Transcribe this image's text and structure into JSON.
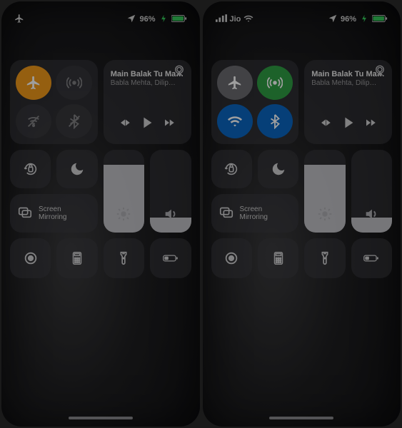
{
  "screens": [
    {
      "status": {
        "left_mode": "airplane",
        "carrier": "",
        "wifi": false,
        "battery_pct": "96%"
      },
      "connectivity": {
        "airplane": {
          "on": true,
          "style": "orange"
        },
        "cellular": {
          "on": false,
          "style": "dim"
        },
        "wifi": {
          "on": false,
          "style": "dim"
        },
        "bluetooth": {
          "on": false,
          "style": "dim"
        }
      },
      "media": {
        "title": "Main Balak Tu Ma…",
        "artist": "Babla Mehta, Dilip…"
      },
      "screen_mirroring": {
        "line1": "Screen",
        "line2": "Mirroring"
      },
      "brightness_pct": 82,
      "volume_pct": 18
    },
    {
      "status": {
        "left_mode": "signal",
        "carrier": "Jio",
        "wifi": true,
        "battery_pct": "96%"
      },
      "connectivity": {
        "airplane": {
          "on": false,
          "style": "grey"
        },
        "cellular": {
          "on": true,
          "style": "green"
        },
        "wifi": {
          "on": true,
          "style": "blue"
        },
        "bluetooth": {
          "on": true,
          "style": "blue"
        }
      },
      "media": {
        "title": "Main Balak Tu Ma…",
        "artist": "Babla Mehta, Dilip…"
      },
      "screen_mirroring": {
        "line1": "Screen",
        "line2": "Mirroring"
      },
      "brightness_pct": 82,
      "volume_pct": 18
    }
  ],
  "colors": {
    "orange": "#f09a1a",
    "green": "#2f9e44",
    "blue": "#0a66c2"
  }
}
